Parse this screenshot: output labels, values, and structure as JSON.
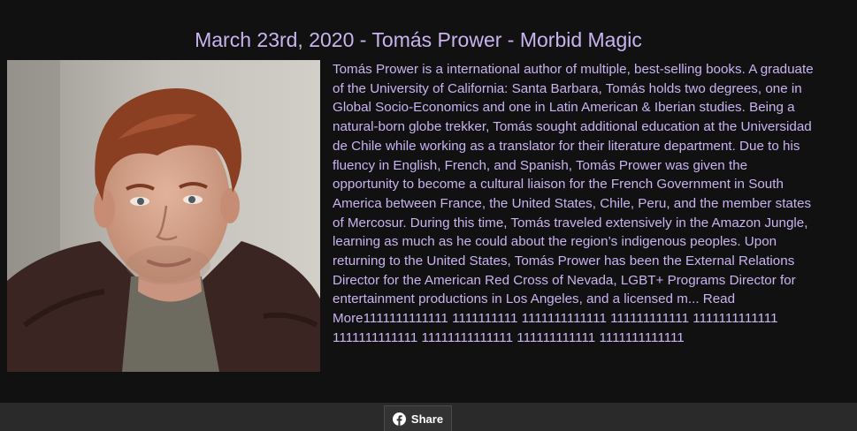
{
  "article": {
    "title": "March 23rd, 2020 - Tomás Prower - Morbid Magic",
    "photo_alt": "Tomás Prower",
    "bio_lines": [
      "Tomás Prower is a international author of multiple, best-selling books. A graduate",
      "of the University of California: Santa Barbara, Tomás holds two degrees, one in",
      "Global Socio-Economics and one in Latin American & Iberian studies. Being a",
      "natural-born globe trekker, Tomás sought additional education at the Universidad",
      "de Chile while working as a translator for their literature department. Due to his",
      "fluency in English, French, and Spanish, Tomás Prower was given the",
      "opportunity to become a cultural liaison for the French Government in South",
      "America between France, the United States, Chile, Peru, and the member states",
      "of Mercosur. During this time, Tomás traveled extensively in the Amazon Jungle,",
      "learning as much as he could about the region’s indigenous peoples. Upon",
      "returning to the United States, Tomás Prower has been the External Relations",
      "Director for the American Red Cross of Nevada, LGBT+ Programs Director for",
      "entertainment productions in Los Angeles, and a licensed m... Read",
      "More1111111111111 1111111111 1111111111111 111111111111 1111111111111",
      "1111111111111 11111111111111 111111111111 1111111111111"
    ]
  },
  "share": {
    "label": "Share",
    "icon": "facebook-icon"
  },
  "colors": {
    "text": "#c9b3f0",
    "background": "#111111",
    "footer": "#2a2a2a"
  }
}
